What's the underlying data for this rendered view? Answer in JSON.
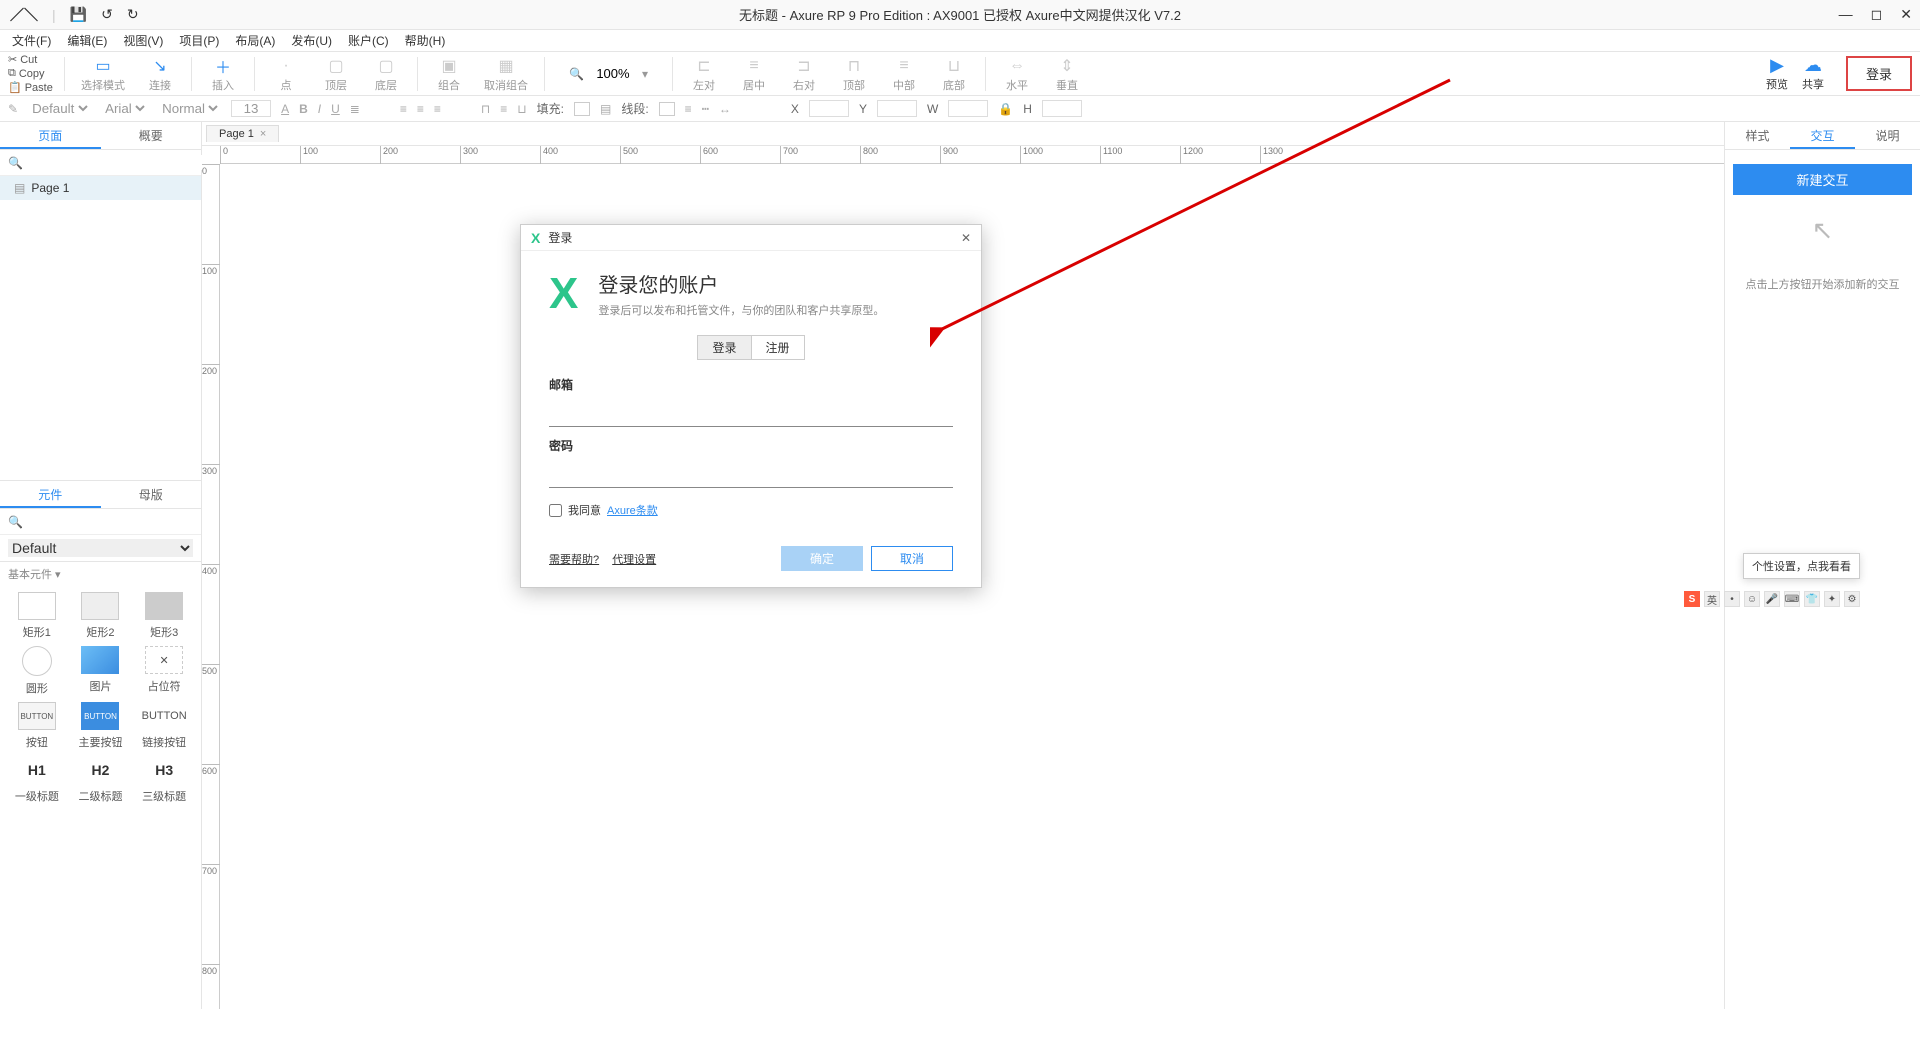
{
  "title": "无标题 - Axure RP 9 Pro Edition : AX9001 已授权    Axure中文网提供汉化 V7.2",
  "menu": {
    "file": "文件(F)",
    "edit": "编辑(E)",
    "view": "视图(V)",
    "project": "项目(P)",
    "arrange": "布局(A)",
    "publish": "发布(U)",
    "account": "账户(C)",
    "help": "帮助(H)"
  },
  "clipboard": {
    "cut": "Cut",
    "copy": "Copy",
    "paste": "Paste"
  },
  "toolbar": {
    "select": "选择模式",
    "connect": "连接",
    "insert": "插入",
    "point": "点",
    "top": "顶层",
    "bottom": "底层",
    "group": "组合",
    "ungroup": "取消组合",
    "zoom": "100%",
    "alignL": "左对",
    "alignC": "居中",
    "alignR": "右对",
    "alignT": "顶部",
    "alignM": "中部",
    "alignB": "底部",
    "distH": "水平",
    "distV": "垂直",
    "preview": "预览",
    "share": "共享",
    "login": "登录"
  },
  "fmt": {
    "style": "Default",
    "font": "Arial",
    "weight": "Normal",
    "size": "13",
    "fill": "填充:",
    "line": "线段:",
    "x": "X",
    "y": "Y",
    "w": "W",
    "h": "H"
  },
  "left": {
    "tabPages": "页面",
    "tabOutline": "概要",
    "page1": "Page 1",
    "tabWidgets": "元件",
    "tabMasters": "母版",
    "lib": "Default",
    "cat": "基本元件 ▾",
    "widgets": [
      {
        "n": "矩形1",
        "c": ""
      },
      {
        "n": "矩形2",
        "c": "fill"
      },
      {
        "n": "矩形3",
        "c": "dark"
      },
      {
        "n": "圆形",
        "c": "circ"
      },
      {
        "n": "图片",
        "c": "img"
      },
      {
        "n": "占位符",
        "c": "noborder",
        "t": "✕"
      },
      {
        "n": "按钮",
        "c": "btn",
        "t": "BUTTON"
      },
      {
        "n": "主要按钮",
        "c": "blue",
        "t": "BUTTON"
      },
      {
        "n": "链接按钮",
        "c": "link",
        "t": "BUTTON"
      },
      {
        "n": "一级标题",
        "c": "h",
        "t": "H1"
      },
      {
        "n": "二级标题",
        "c": "h",
        "t": "H2"
      },
      {
        "n": "三级标题",
        "c": "h",
        "t": "H3"
      }
    ]
  },
  "canvas": {
    "tab": "Page 1",
    "hticks": [
      0,
      100,
      200,
      300,
      400,
      500,
      600,
      700,
      800,
      900,
      1000,
      1100,
      1200,
      1300
    ],
    "vticks": [
      0,
      100,
      200,
      300,
      400,
      500,
      600,
      700,
      800
    ]
  },
  "right": {
    "style": "样式",
    "interact": "交互",
    "notes": "说明",
    "newInt": "新建交互",
    "hint": "点击上方按钮开始添加新的交互"
  },
  "dialog": {
    "title": "登录",
    "heading": "登录您的账户",
    "sub": "登录后可以发布和托管文件，与你的团队和客户共享原型。",
    "tabLogin": "登录",
    "tabReg": "注册",
    "email": "邮箱",
    "password": "密码",
    "agreePrefix": "我同意",
    "agreeLink": "Axure条款",
    "help": "需要帮助?",
    "proxy": "代理设置",
    "ok": "确定",
    "cancel": "取消"
  },
  "ime": {
    "tip": "个性设置，点我看看",
    "first": "英"
  }
}
